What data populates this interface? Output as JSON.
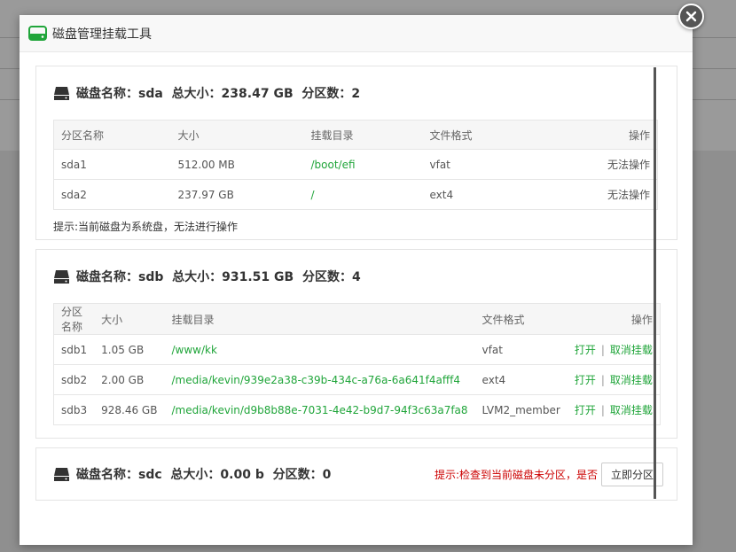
{
  "modal": {
    "title": "磁盘管理挂载工具"
  },
  "colors": {
    "accent_green": "#20a53a",
    "warning_red": "#cc0000"
  },
  "icons": {
    "header": "hard-drive-icon",
    "disk": "disk-icon",
    "close": "close-icon"
  },
  "disks": [
    {
      "name_label": "磁盘名称：sda",
      "size_label": "总大小：238.47 GB",
      "count_label": "分区数：2",
      "columns": [
        "分区名称",
        "大小",
        "挂载目录",
        "文件格式",
        "操作"
      ],
      "rows": [
        {
          "name": "sda1",
          "size": "512.00 MB",
          "mount": "/boot/efi",
          "fs": "vfat",
          "op": "无法操作"
        },
        {
          "name": "sda2",
          "size": "237.97 GB",
          "mount": "/",
          "fs": "ext4",
          "op": "无法操作"
        }
      ],
      "tip": "提示:当前磁盘为系统盘，无法进行操作"
    },
    {
      "name_label": "磁盘名称：sdb",
      "size_label": "总大小：931.51 GB",
      "count_label": "分区数：4",
      "columns": [
        "分区名称",
        "大小",
        "挂载目录",
        "文件格式",
        "操作"
      ],
      "ops": {
        "open": "打开",
        "sep": "|",
        "unmount": "取消挂载"
      },
      "rows": [
        {
          "name": "sdb1",
          "size": "1.05 GB",
          "mount": "/www/kk",
          "fs": "vfat"
        },
        {
          "name": "sdb2",
          "size": "2.00 GB",
          "mount": "/media/kevin/939e2a38-c39b-434c-a76a-6a641f4afff4",
          "fs": "ext4"
        },
        {
          "name": "sdb3",
          "size": "928.46 GB",
          "mount": "/media/kevin/d9b8b88e-7031-4e42-b9d7-94f3c63a7fa8",
          "fs": "LVM2_member"
        }
      ]
    },
    {
      "name_label": "磁盘名称：sdc",
      "size_label": "总大小：0.00 b",
      "count_label": "分区数：0",
      "warning": "提示:检查到当前磁盘未分区，是否",
      "button": "立即分区"
    }
  ]
}
